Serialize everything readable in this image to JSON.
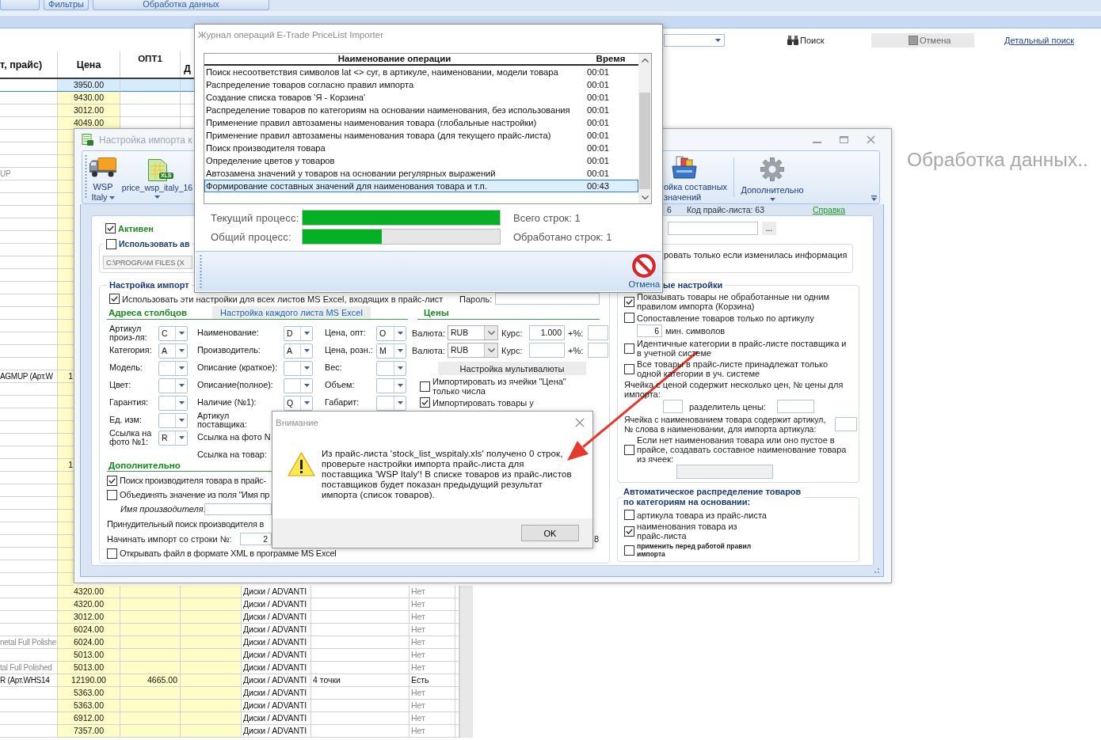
{
  "app": {
    "tabs": [
      "Фильтры",
      "Обработка данных"
    ],
    "toolbar": {
      "search_button": "Поиск",
      "cancel_button": "Отмена",
      "advanced_search_link": "Детальный поиск"
    },
    "table": {
      "columns": [
        "т, прайс)",
        "Цена",
        "ОПТ1",
        "Д"
      ],
      "rows": [
        {
          "selected": true,
          "price": "3950.00"
        },
        {
          "selected": false,
          "price": "9430.00"
        },
        {
          "selected": false,
          "price": "3012.00"
        },
        {
          "selected": false,
          "price": "4049.00"
        },
        {
          "selected": false
        },
        {
          "selected": false
        },
        {
          "selected": false
        },
        {
          "selected": false,
          "column_1": "UP",
          "in_stock": false
        },
        {
          "selected": false
        },
        {
          "selected": false
        },
        {
          "selected": false
        },
        {
          "selected": false
        },
        {
          "selected": false
        },
        {
          "selected": false
        },
        {
          "selected": false
        },
        {
          "selected": false
        },
        {
          "selected": false
        },
        {
          "selected": false
        },
        {
          "selected": false
        },
        {
          "selected": false
        },
        {
          "selected": false
        },
        {
          "selected": false
        },
        {
          "selected": false
        },
        {
          "selected": false,
          "column_1": "AGMUP (Арт.W",
          "price": "1",
          "in_stock": true
        },
        {
          "selected": false
        },
        {
          "selected": false
        },
        {
          "selected": false
        },
        {
          "selected": false
        },
        {
          "selected": false
        },
        {
          "selected": false
        },
        {
          "selected": false,
          "price": "1"
        },
        {
          "selected": false
        },
        {
          "selected": false
        },
        {
          "selected": false
        },
        {
          "selected": false
        },
        {
          "selected": false
        },
        {
          "selected": false
        },
        {
          "selected": false
        },
        {
          "selected": false
        },
        {
          "selected": false
        },
        {
          "selected": false,
          "price": "4320.00",
          "column_5": "Диски / ADVANTI",
          "column_7": "Нет",
          "in_stock": false
        },
        {
          "selected": false,
          "price": "4320.00",
          "column_5": "Диски / ADVANTI",
          "column_7": "Нет",
          "in_stock": false
        },
        {
          "selected": false,
          "price": "3012.00",
          "column_5": "Диски / ADVANTI",
          "column_7": "Нет",
          "in_stock": false
        },
        {
          "selected": false,
          "price": "6024.00",
          "column_5": "Диски / ADVANTI",
          "column_7": "Нет",
          "in_stock": false
        },
        {
          "selected": false,
          "column_1": "netal Full Polishe",
          "price": "6024.00",
          "column_5": "Диски / ADVANTI",
          "column_7": "Нет",
          "in_stock": false
        },
        {
          "selected": false,
          "price": "5013.00",
          "column_5": "Диски / ADVANTI",
          "column_7": "Нет",
          "in_stock": false
        },
        {
          "selected": false,
          "column_1": "tal Full Polished",
          "price": "5013.00",
          "column_5": "Диски / ADVANTI",
          "column_7": "Нет",
          "in_stock": false
        },
        {
          "selected": false,
          "column_1": "R (Арт.WHS14",
          "price": "12190.00",
          "opt1": "4665.00",
          "column_5": "Диски / ADVANTI",
          "column_6": "4 точки",
          "column_7": "Есть",
          "in_stock": true
        },
        {
          "selected": false,
          "price": "5363.00",
          "column_5": "Диски / ADVANTI",
          "column_7": "Нет",
          "in_stock": false
        },
        {
          "selected": false,
          "price": "5363.00",
          "column_5": "Диски / ADVANTI",
          "column_7": "Нет",
          "in_stock": false
        },
        {
          "selected": false,
          "price": "6912.00",
          "column_5": "Диски / ADVANTI",
          "column_7": "Нет",
          "in_stock": false
        },
        {
          "selected": false,
          "price": "7357.00",
          "column_5": "Диски / ADVANTI",
          "column_7": "Нет",
          "in_stock": false
        }
      ]
    },
    "status_text": "Обработка данных.."
  },
  "settings_window": {
    "title": "Настройка импорта к",
    "ribbon": [
      {
        "label": "WSP Italy",
        "dropdown": true
      },
      {
        "label": "price_wsp_italy_16",
        "dropdown": true,
        "badge": "XLS"
      },
      {
        "label": "ойка составных значений",
        "dropdown": false
      },
      {
        "label": "Дополнительно",
        "dropdown": true
      }
    ],
    "info": [
      "6",
      "Код прайс-листа: 63"
    ],
    "help_link": "Справка",
    "active": {
      "label": "Активен",
      "checked": true
    },
    "browse_button": "...",
    "use_auto": {
      "label": "Использовать ав",
      "checked": false
    },
    "path": "C:\\PROGRAM FILES (X",
    "import_if_changed": "ровать только если изменилась информация",
    "import_settings": {
      "title": "Настройка импорт",
      "all_sheets": {
        "label": "Использовать эти настройки для всех листов MS Excel, входящих в прайс-лист",
        "checked": true
      },
      "password_label": "Пароль:",
      "columns_title": "Адреса столбцов",
      "each_sheet_button": "Настройка каждого листа MS Excel",
      "prices_title": "Цены",
      "column_fields": [
        [
          {
            "label": "Артикул произ-ля:",
            "kind": "combo",
            "value": "C"
          },
          {
            "label": "Категория:",
            "kind": "combo",
            "value": "A"
          },
          {
            "label": "Модель:",
            "kind": "combo"
          },
          {
            "label": "Цвет:",
            "kind": "combo"
          },
          {
            "label": "Гарантия:",
            "kind": "combo"
          },
          {
            "label": "Ед. изм:",
            "kind": "combo"
          },
          {
            "label": "Ссылка на фото №1:",
            "kind": "combo",
            "value": "R"
          }
        ],
        [
          {
            "label": "Наименование:",
            "kind": "combo",
            "value": "D"
          },
          {
            "label": "Производитель:",
            "kind": "combo",
            "value": "A"
          },
          {
            "label": "Описание (краткое):",
            "kind": "combo"
          },
          {
            "label": "Описание(полное):",
            "kind": "combo"
          },
          {
            "label": "Наличие (№1):",
            "kind": "combo",
            "value": "Q"
          },
          {
            "label": "Артикул поставщика:",
            "kind": "label"
          },
          {
            "label": "Ссылка на фото N",
            "kind": "label"
          },
          {
            "label": "Ссылка на товар:",
            "kind": "label"
          }
        ],
        [
          {
            "label": "Цена, опт:",
            "kind": "combo",
            "value": "O"
          },
          {
            "label": "Цена, розн.:",
            "kind": "combo",
            "value": "M"
          },
          {
            "label": "Вес:",
            "kind": "combo"
          },
          {
            "label": "Объем:",
            "kind": "combo"
          },
          {
            "label": "Габарит:",
            "kind": "combo"
          }
        ]
      ],
      "prices": [
        {
          "currency_label": "Валюта:",
          "currency": "RUB",
          "rate_label": "Курс:",
          "rate": "1.000",
          "markup_label": "+%:"
        },
        {
          "currency_label": "Валюта:",
          "currency": "RUB",
          "rate_label": "Курс:",
          "markup_label": "+%:"
        }
      ],
      "multicurrency_button": "Настройка мультивалюты",
      "price_options": [
        {
          "label": "Импортировать из ячейки \"Цена\" только числа",
          "checked": false
        },
        {
          "label": "Импортировать товары у",
          "checked": true
        }
      ],
      "additional_title": "Дополнительно",
      "additional": [
        {
          "kind": "checkbox",
          "label": "Поиск производителя товара в прайс-",
          "checked": true
        },
        {
          "kind": "checkbox",
          "label": "Объединять значение из поля \"Имя пр",
          "checked": false
        },
        {
          "kind": "input",
          "label": "Имя производителя:"
        },
        {
          "kind": "text",
          "label": "Принудительный поиск производителя в"
        },
        {
          "kind": "number",
          "label": "Начинать импорт со строки №:",
          "value": "2"
        },
        {
          "kind": "checkbox",
          "label": "Открывать файл в формате XML в программе MS Excel",
          "checked": false
        }
      ],
      "clipped_value": "8"
    },
    "general_settings": {
      "title": "ые настройки",
      "options": [
        {
          "kind": "checkbox",
          "label": "Показывать товары не обработанные ни одним правилом импорта (Корзина)",
          "checked": true
        },
        {
          "kind": "checkbox",
          "label": "Сопоставление товаров только по артикулу",
          "checked": false
        },
        {
          "kind": "length",
          "value": "6",
          "unit": "мин. символов"
        },
        {
          "kind": "checkbox",
          "label": "Идентичные категории в прайс-листе поставщика и в учетной системе",
          "checked": false
        },
        {
          "kind": "checkbox",
          "label": "Все товары в прайс-листе принадлежат только одной категории в уч. системе",
          "checked": false
        },
        {
          "kind": "price_cell",
          "label": "Ячейка с ценой содержит несколько цен, № цены для импорта:",
          "separator_label": "разделитель цены:"
        },
        {
          "kind": "name_cell",
          "label": "Ячейка с наименованием товара содержит артикул, № слова в наименовании, для импорта артикула:"
        },
        {
          "kind": "compose",
          "label": "Если нет наименования товара или оно пустое в прайсе, создавать составное наименование товара из ячеек:",
          "checked": false
        }
      ]
    },
    "auto_distribution": {
      "title": "Автоматическое распределение товаров по категориям на основании:",
      "options": [
        {
          "kind": "normal",
          "label": "артикула товара из прайс-листа",
          "checked": false
        },
        {
          "kind": "normal",
          "label": "наименования товара из прайс-листа",
          "checked": true
        },
        {
          "kind": "small",
          "label": "применить перед работой правил импорта",
          "checked": false
        }
      ]
    }
  },
  "log_window": {
    "title": "Журнал операций E-Trade PriceList Importer",
    "columns": [
      "Наименование операции",
      "Время"
    ],
    "rows": [
      {
        "operation": "Поиск несоответствия символов lat <> cyr, в артикуле, наименовании, модели товара",
        "time": "00:01",
        "selected": false
      },
      {
        "operation": "Распределение товаров согласно правил импорта",
        "time": "00:01",
        "selected": false
      },
      {
        "operation": "Создание списка товаров 'Я - Корзина'",
        "time": "00:01",
        "selected": false
      },
      {
        "operation": "Распределение товаров по категориям на основании наименования, без использования",
        "time": "00:01",
        "selected": false
      },
      {
        "operation": "Применение правил автозамены наименования товара (глобальные настройки)",
        "time": "00:01",
        "selected": false
      },
      {
        "operation": "Применение правил автозамены наименования товара (для текущего прайс-листа)",
        "time": "00:01",
        "selected": false
      },
      {
        "operation": "Поиск производителя товара",
        "time": "00:01",
        "selected": false
      },
      {
        "operation": "Определение цветов у товаров",
        "time": "00:01",
        "selected": false
      },
      {
        "operation": "Автозамена значений у товаров на основании регулярных выражений",
        "time": "00:01",
        "selected": false
      },
      {
        "operation": "Формирование составных значений для наименования товара и т.п.",
        "time": "00:43",
        "selected": true
      }
    ],
    "progress": [
      {
        "label": "Текущий процесс:",
        "level": 1,
        "info": "Всего строк: 1"
      },
      {
        "label": "Общий процесс:",
        "level": 0.4,
        "info": "Обработано строк: 1"
      }
    ],
    "cancel_button": "Отмена"
  },
  "alert": {
    "title": "Внимание",
    "message": "Из прайс-листа 'stock_list_wspitaly.xls' получено 0 строк, проверьте настройки импорта прайс-листа для поставщика 'WSP Italy'! В списке товаров из прайс-листов поставщиков будет показан предыдущий результат импорта (список товаров).",
    "ok_button": "OK"
  }
}
